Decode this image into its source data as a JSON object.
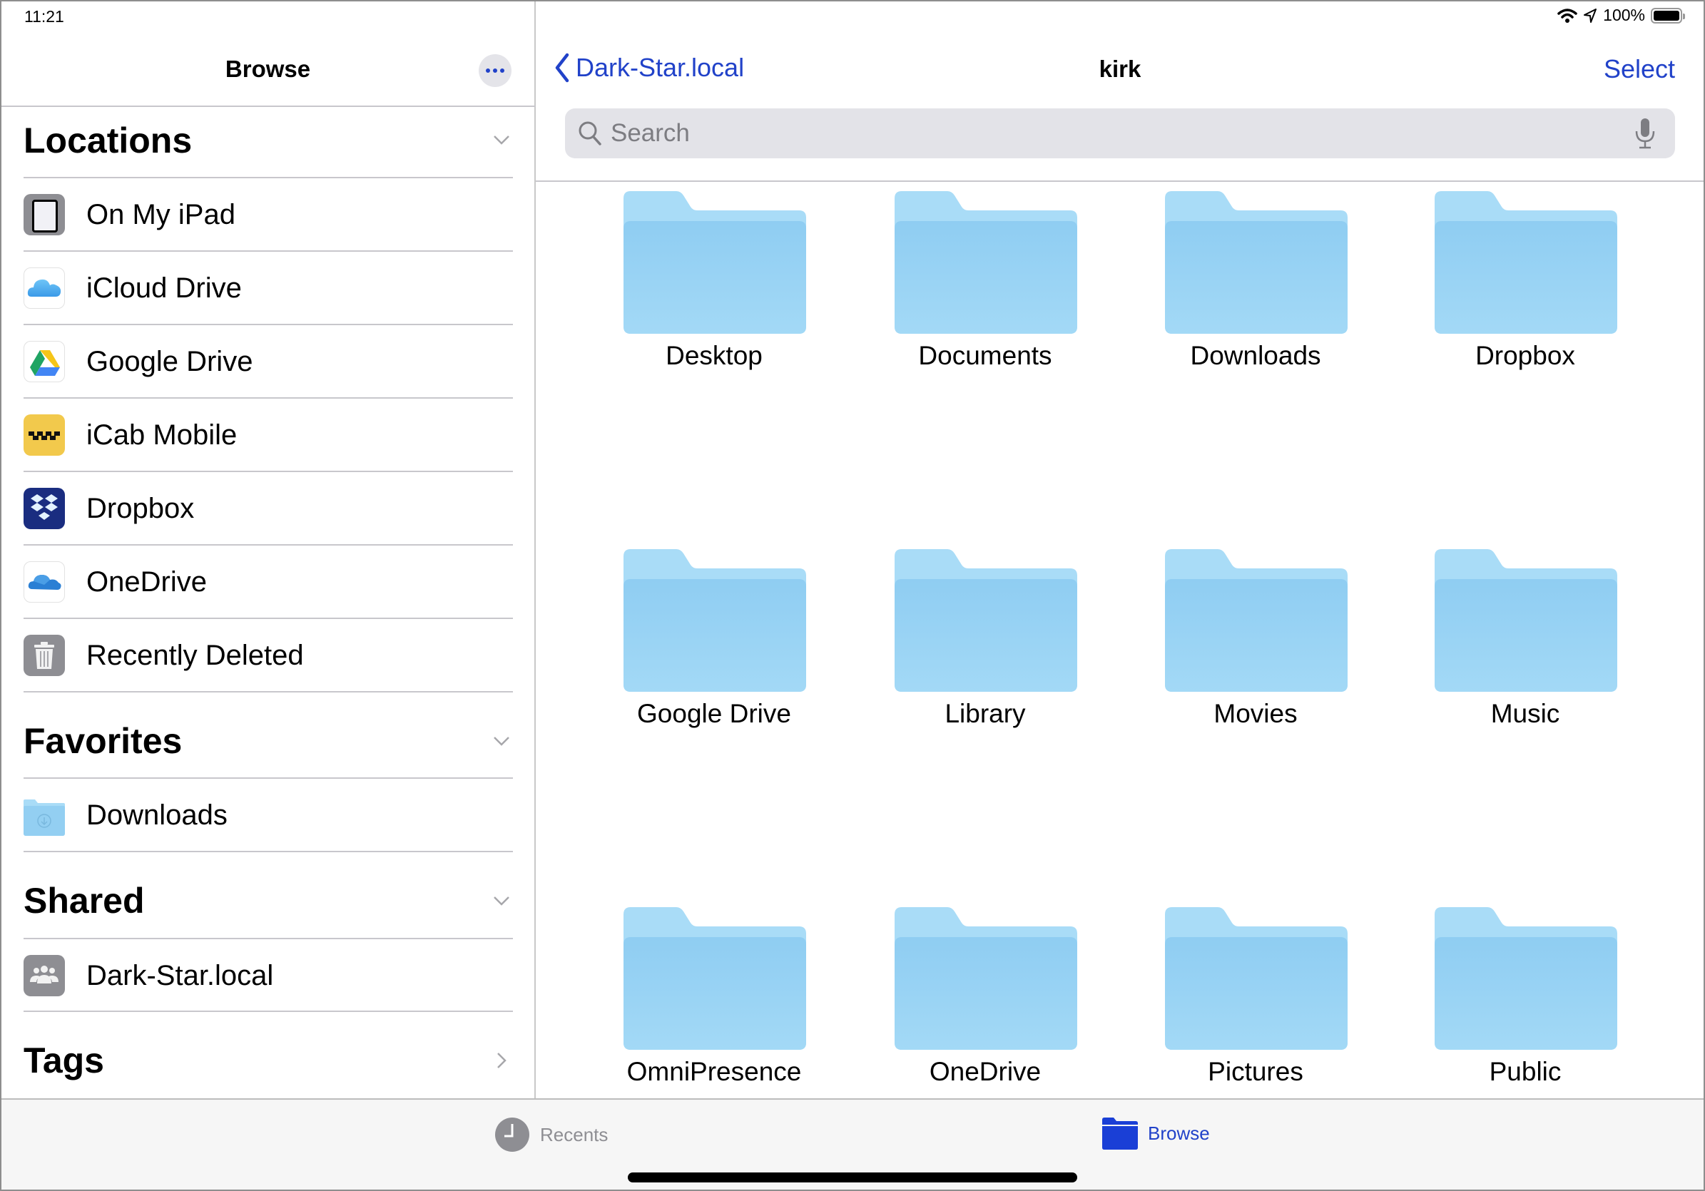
{
  "status_bar": {
    "time": "11:21",
    "battery_percent": "100%",
    "battery_level": 1.0,
    "icons": [
      "wifi-icon",
      "location-arrow-icon",
      "battery-icon"
    ]
  },
  "sidebar": {
    "title": "Browse",
    "more_icon": "ellipsis-icon",
    "sections": {
      "locations": {
        "title": "Locations",
        "expanded": true,
        "items": [
          {
            "label": "On My iPad",
            "icon": "ipad-icon"
          },
          {
            "label": "iCloud Drive",
            "icon": "icloud-icon"
          },
          {
            "label": "Google Drive",
            "icon": "google-drive-icon"
          },
          {
            "label": "iCab Mobile",
            "icon": "icab-mobile-icon"
          },
          {
            "label": "Dropbox",
            "icon": "dropbox-icon"
          },
          {
            "label": "OneDrive",
            "icon": "onedrive-icon"
          },
          {
            "label": "Recently Deleted",
            "icon": "trash-icon"
          }
        ]
      },
      "favorites": {
        "title": "Favorites",
        "expanded": true,
        "items": [
          {
            "label": "Downloads",
            "icon": "downloads-folder-icon"
          }
        ]
      },
      "shared": {
        "title": "Shared",
        "expanded": true,
        "items": [
          {
            "label": "Dark-Star.local",
            "icon": "shared-server-icon"
          }
        ]
      },
      "tags": {
        "title": "Tags",
        "expanded": false
      }
    }
  },
  "main": {
    "back_label": "Dark-Star.local",
    "title": "kirk",
    "select_label": "Select",
    "search": {
      "placeholder": "Search",
      "value": ""
    },
    "folders": [
      {
        "name": "Desktop"
      },
      {
        "name": "Documents"
      },
      {
        "name": "Downloads"
      },
      {
        "name": "Dropbox"
      },
      {
        "name": "Google Drive"
      },
      {
        "name": "Library"
      },
      {
        "name": "Movies"
      },
      {
        "name": "Music"
      },
      {
        "name": "OmniPresence"
      },
      {
        "name": "OneDrive"
      },
      {
        "name": "Pictures"
      },
      {
        "name": "Public"
      }
    ]
  },
  "tab_bar": {
    "tabs": [
      {
        "label": "Recents",
        "icon": "clock-icon",
        "active": false
      },
      {
        "label": "Browse",
        "icon": "folder-icon",
        "active": true
      }
    ]
  },
  "colors": {
    "accent": "#2142c9",
    "folder_light": "#a9dcf7",
    "folder_body": "#93cff2",
    "inactive_tab": "#8e8e93"
  }
}
